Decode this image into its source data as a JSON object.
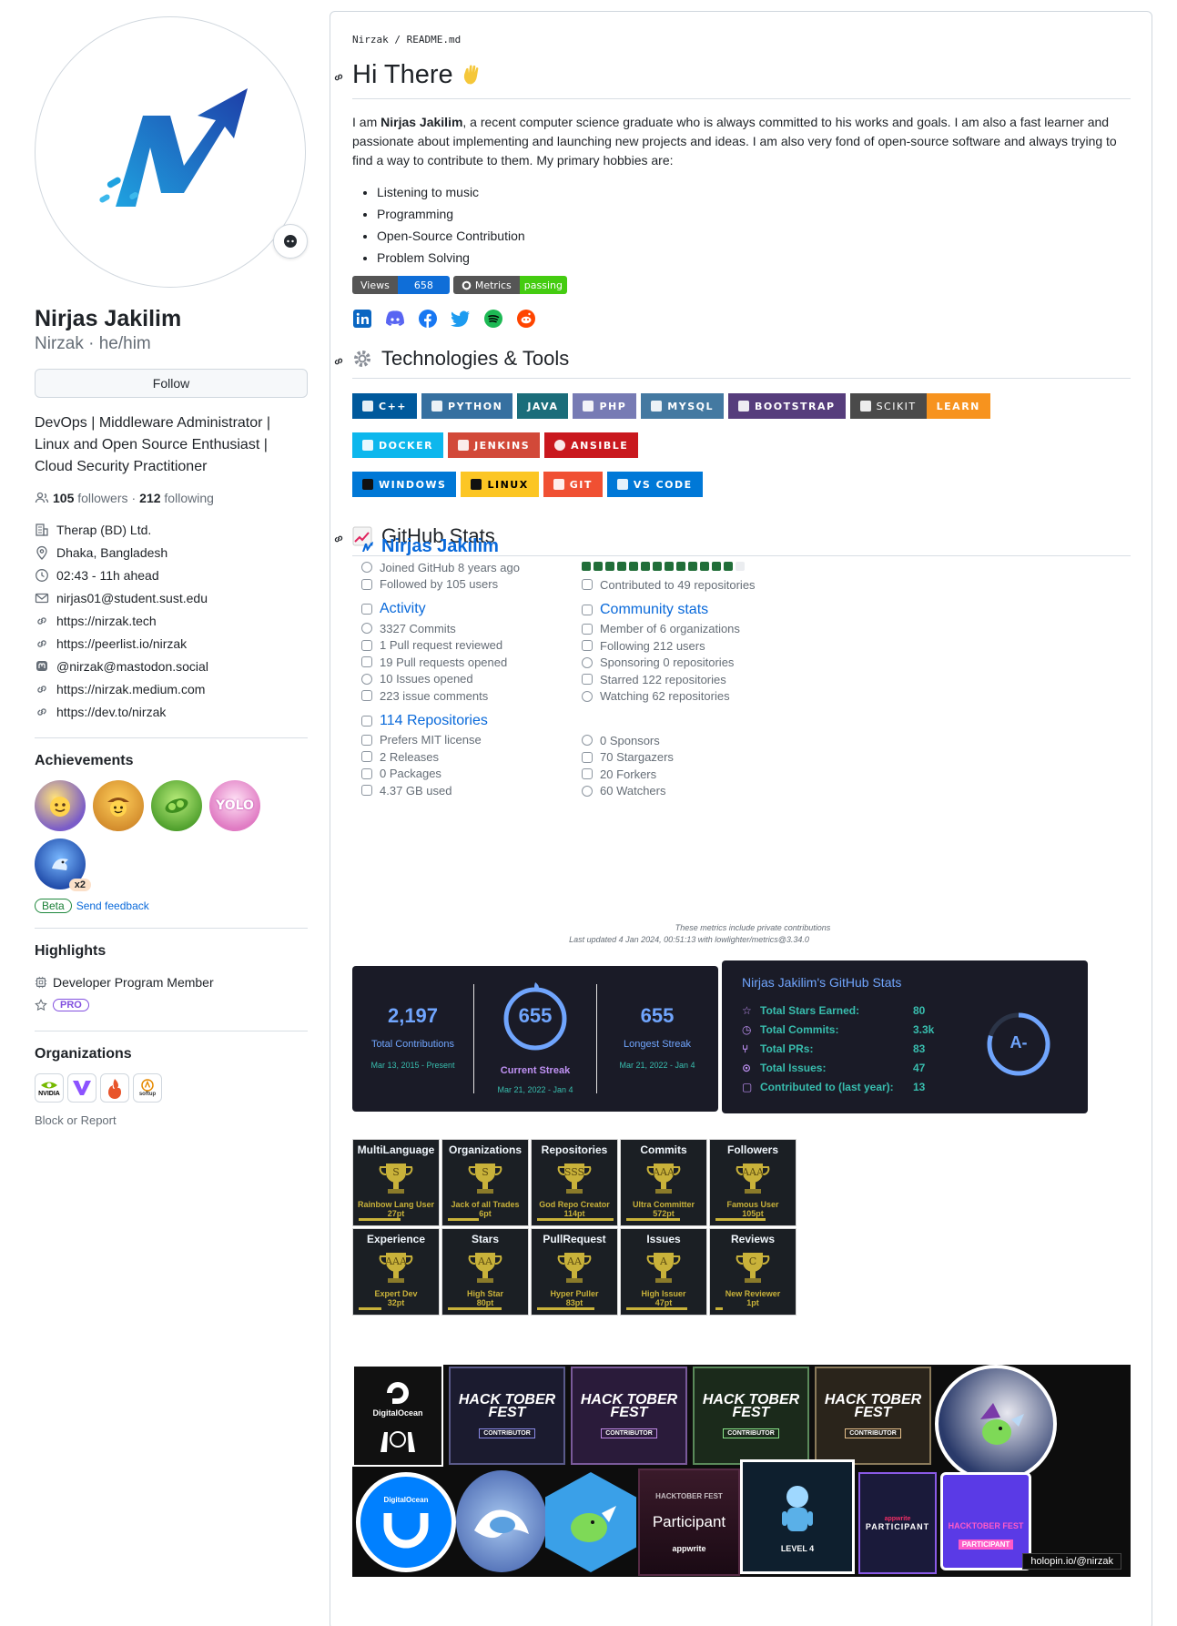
{
  "profile": {
    "name": "Nirjas Jakilim",
    "login_line": "Nirzak · he/him",
    "follow_label": "Follow",
    "bio": "DevOps | Middleware Administrator | Linux and Open Source Enthusiast | Cloud Security Practitioner",
    "followers_count": "105",
    "followers_label": "followers",
    "following_count": "212",
    "following_label": "following",
    "details": [
      {
        "icon": "organization-icon",
        "text": "Therap (BD) Ltd."
      },
      {
        "icon": "location-icon",
        "text": "Dhaka, Bangladesh"
      },
      {
        "icon": "clock-icon",
        "text": "02:43 - 11h ahead"
      },
      {
        "icon": "mail-icon",
        "text": "nirjas01@student.sust.edu"
      },
      {
        "icon": "link-icon",
        "text": "https://nirzak.tech"
      },
      {
        "icon": "link-icon",
        "text": "https://peerlist.io/nirzak"
      },
      {
        "icon": "mastodon-icon",
        "text": "@nirzak@mastodon.social"
      },
      {
        "icon": "link-icon",
        "text": "https://nirzak.medium.com"
      },
      {
        "icon": "link-icon",
        "text": "https://dev.to/nirzak"
      }
    ]
  },
  "achievements": {
    "heading": "Achievements",
    "x2": "x2",
    "beta": "Beta",
    "feedback": "Send feedback"
  },
  "highlights": {
    "heading": "Highlights",
    "member": "Developer Program Member",
    "pro": "PRO"
  },
  "organizations": {
    "heading": "Organizations",
    "items": [
      "NVIDIA",
      "",
      "",
      "softup"
    ],
    "block": "Block or Report"
  },
  "readme": {
    "crumb": "Nirzak / README.md",
    "title": "Hi There",
    "intro_pre": "I am ",
    "intro_name": "Nirjas Jakilim",
    "intro_post": ", a recent computer science graduate who is always committed to his works and goals. I am also a fast learner and passionate about implementing and launching new projects and ideas. I am also very fond of open-source software and always trying to find a way to contribute to them. My primary hobbies are:",
    "hobbies": [
      "Listening to music",
      "Programming",
      "Open-Source Contribution",
      "Problem Solving"
    ],
    "views_label": "Views",
    "views_value": "658",
    "metrics_label": "Metrics",
    "metrics_value": "passing",
    "tech_heading": "Technologies & Tools",
    "tech_rows": [
      [
        {
          "label": "C++",
          "color": "#00599c"
        },
        {
          "label": "PYTHON",
          "color": "#3670a0"
        },
        {
          "label": "JAVA",
          "color": "#1b6d7a"
        },
        {
          "label": "PHP",
          "color": "#777bb4"
        },
        {
          "label": "MYSQL",
          "color": "#4479a1"
        },
        {
          "label": "BOOTSTRAP",
          "color": "#563d7c"
        },
        {
          "label": "SCIKIT",
          "color": "#4a4a4a"
        },
        {
          "label": "LEARN",
          "color": "#f7931e"
        }
      ],
      [
        {
          "label": "DOCKER",
          "color": "#0db7ed"
        },
        {
          "label": "JENKINS",
          "color": "#d24939"
        },
        {
          "label": "ANSIBLE",
          "color": "#c9181e"
        }
      ],
      [
        {
          "label": "WINDOWS",
          "color": "#0078d6"
        },
        {
          "label": "LINUX",
          "color": "#fcc624"
        },
        {
          "label": "GIT",
          "color": "#f05033"
        },
        {
          "label": "VS CODE",
          "color": "#0078d7"
        }
      ]
    ],
    "stats_heading": "GitHub Stats"
  },
  "metrics": {
    "name": "Nirjas Jakilim",
    "joined": "Joined GitHub 8 years ago",
    "followed": "Followed by 105 users",
    "contributed": "Contributed to 49 repositories",
    "activity_title": "Activity",
    "activity": [
      "3327 Commits",
      "1 Pull request reviewed",
      "19 Pull requests opened",
      "10 Issues opened",
      "223 issue comments"
    ],
    "community_title": "Community stats",
    "community": [
      "Member of 6 organizations",
      "Following 212 users",
      "Sponsoring 0 repositories",
      "Starred 122 repositories",
      "Watching 62 repositories"
    ],
    "repos_title": "114 Repositories",
    "repos": [
      "Prefers MIT license",
      "2 Releases",
      "0 Packages",
      "4.37 GB used"
    ],
    "repos_right": [
      "0 Sponsors",
      "70 Stargazers",
      "20 Forkers",
      "60 Watchers"
    ],
    "note1": "These metrics include private contributions",
    "note2": "Last updated 4 Jan 2024, 00:51:13 with lowlighter/metrics@3.34.0"
  },
  "streak": {
    "total_value": "2,197",
    "total_label": "Total Contributions",
    "total_range": "Mar 13, 2015 - Present",
    "current_value": "655",
    "current_label": "Current Streak",
    "current_range": "Mar 21, 2022 - Jan 4",
    "longest_value": "655",
    "longest_label": "Longest Streak",
    "longest_range": "Mar 21, 2022 - Jan 4"
  },
  "gh_stats": {
    "title": "Nirjas Jakilim's GitHub Stats",
    "rows": [
      {
        "label": "Total Stars Earned:",
        "value": "80"
      },
      {
        "label": "Total Commits:",
        "value": "3.3k"
      },
      {
        "label": "Total PRs:",
        "value": "83"
      },
      {
        "label": "Total Issues:",
        "value": "47"
      },
      {
        "label": "Contributed to (last year):",
        "value": "13"
      }
    ],
    "grade": "A-"
  },
  "trophies": [
    {
      "head": "MultiLanguage",
      "rank": "S",
      "name": "Rainbow Lang User",
      "points": "27pt",
      "progress": 0.55
    },
    {
      "head": "Organizations",
      "rank": "S",
      "name": "Jack of all Trades",
      "points": "6pt",
      "progress": 0.4
    },
    {
      "head": "Repositories",
      "rank": "SSS",
      "name": "God Repo Creator",
      "points": "114pt",
      "progress": 1.0
    },
    {
      "head": "Commits",
      "rank": "AAA",
      "name": "Ultra Committer",
      "points": "572pt",
      "progress": 0.7
    },
    {
      "head": "Followers",
      "rank": "AAA",
      "name": "Famous User",
      "points": "105pt",
      "progress": 0.65
    },
    {
      "head": "Experience",
      "rank": "AAA",
      "name": "Expert Dev",
      "points": "32pt",
      "progress": 0.3
    },
    {
      "head": "Stars",
      "rank": "AA",
      "name": "High Star",
      "points": "80pt",
      "progress": 0.7
    },
    {
      "head": "PullRequest",
      "rank": "AA",
      "name": "Hyper Puller",
      "points": "83pt",
      "progress": 0.75
    },
    {
      "head": "Issues",
      "rank": "A",
      "name": "High Issuer",
      "points": "47pt",
      "progress": 0.8
    },
    {
      "head": "Reviews",
      "rank": "C",
      "name": "New Reviewer",
      "points": "1pt",
      "progress": 0.1
    }
  ],
  "holopin": {
    "caption": "holopin.io/@nirzak",
    "badges": [
      "DigitalOcean",
      "HACK TOBER FEST",
      "HACK TOBER FEST",
      "HACK TOBER FEST",
      "HACK TOBER FEST",
      "DigitalOcean",
      "Participant",
      "LEVEL 4",
      "PARTICIPANT",
      "PARTICIPANT"
    ],
    "contributor": "CONTRIBUTOR",
    "appwrite": "appwrite",
    "hf_fest": "HACKTOBER FEST",
    "level_label": "LEVEL"
  }
}
